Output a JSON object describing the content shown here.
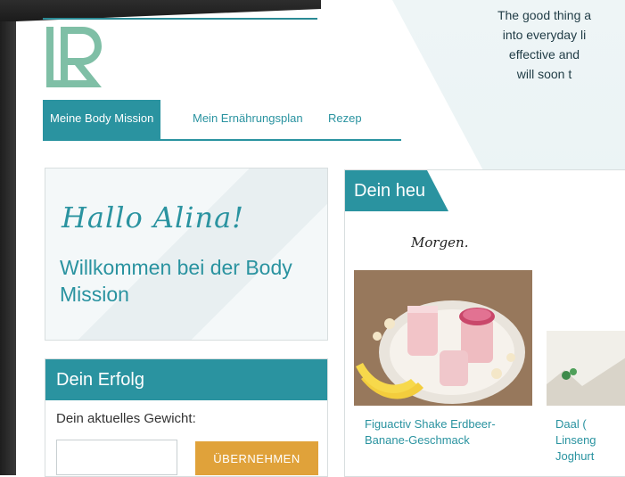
{
  "promo": {
    "lines": [
      "The good thing a",
      "into everyday li",
      "effective and",
      "will soon t"
    ]
  },
  "header": {
    "logo_text": "LR"
  },
  "nav": {
    "items": [
      {
        "label": "Meine Body Mission",
        "active": true
      },
      {
        "label": "Mein Ernährungsplan",
        "active": false
      },
      {
        "label": "Rezep",
        "active": false
      }
    ]
  },
  "welcome": {
    "greeting": "Hallo Alina!",
    "message": "Willkommen bei der Body Mission"
  },
  "success": {
    "title": "Dein Erfolg",
    "weight_label": "Dein aktuelles Gewicht:",
    "weight_value": "",
    "apply_button": "ÜBERNEHMEN"
  },
  "day": {
    "title": "Dein heu",
    "meal": "Morgen.",
    "recipes": [
      {
        "name": "Figuactiv Shake Erdbeer-Banane-Geschmack"
      },
      {
        "name_lines": [
          "Daal (",
          "Linseng",
          "Joghurt"
        ]
      }
    ]
  },
  "colors": {
    "teal": "#2a93a0",
    "orange": "#e0a23a",
    "logo": "#7fbfa6"
  }
}
